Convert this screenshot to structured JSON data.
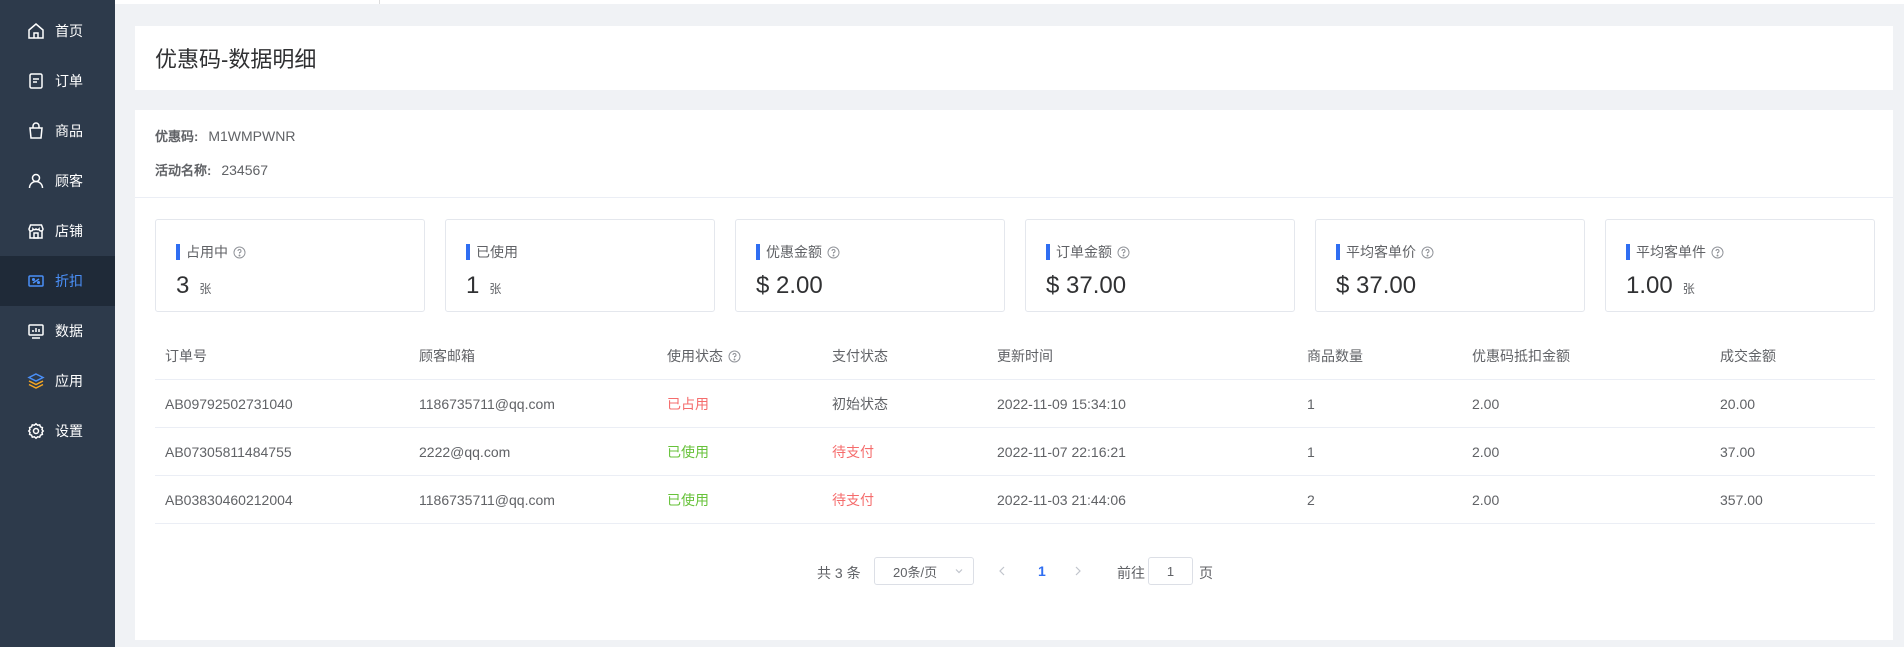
{
  "sidebar": {
    "items": [
      {
        "label": "首页",
        "icon": "home-icon"
      },
      {
        "label": "订单",
        "icon": "order-icon"
      },
      {
        "label": "商品",
        "icon": "bag-icon"
      },
      {
        "label": "顾客",
        "icon": "user-icon"
      },
      {
        "label": "店铺",
        "icon": "store-icon"
      },
      {
        "label": "折扣",
        "icon": "discount-icon"
      },
      {
        "label": "数据",
        "icon": "chart-icon"
      },
      {
        "label": "应用",
        "icon": "app-icon"
      },
      {
        "label": "设置",
        "icon": "gear-icon"
      }
    ],
    "active_index": 5,
    "active_color": "#4a8ff7",
    "background": "#2d3a4b"
  },
  "header": {
    "title": "优惠码-数据明细"
  },
  "info": {
    "code_label": "优惠码:",
    "code_value": "M1WMPWNR",
    "activity_label": "活动名称:",
    "activity_value": "234567"
  },
  "stats": [
    {
      "label": "占用中",
      "value": "3",
      "unit": "张",
      "help": true
    },
    {
      "label": "已使用",
      "value": "1",
      "unit": "张",
      "help": false
    },
    {
      "label": "优惠金额",
      "value": "$ 2.00",
      "unit": "",
      "help": true
    },
    {
      "label": "订单金额",
      "value": "$ 37.00",
      "unit": "",
      "help": true
    },
    {
      "label": "平均客单价",
      "value": "$ 37.00",
      "unit": "",
      "help": true
    },
    {
      "label": "平均客单件",
      "value": "1.00",
      "unit": "张",
      "help": true
    }
  ],
  "table": {
    "columns": [
      "订单号",
      "顾客邮箱",
      "使用状态",
      "支付状态",
      "更新时间",
      "商品数量",
      "优惠码抵扣金额",
      "成交金额"
    ],
    "rows": [
      [
        "AB09792502731040",
        "1186735711@qq.com",
        "已占用",
        "初始状态",
        "2022-11-09 15:34:10",
        "1",
        "2.00",
        "20.00"
      ],
      [
        "AB07305811484755",
        "2222@qq.com",
        "已使用",
        "待支付",
        "2022-11-07 22:16:21",
        "1",
        "2.00",
        "37.00"
      ],
      [
        "AB03830460212004",
        "1186735711@qq.com",
        "已使用",
        "待支付",
        "2022-11-03 21:44:06",
        "2",
        "2.00",
        "357.00"
      ]
    ],
    "row_colors": [
      [
        "",
        "",
        "#f56c6c",
        "",
        "",
        "",
        "",
        ""
      ],
      [
        "",
        "",
        "#67c23a",
        "#f56c6c",
        "",
        "",
        "",
        ""
      ],
      [
        "",
        "",
        "#67c23a",
        "#f56c6c",
        "",
        "",
        "",
        ""
      ]
    ]
  },
  "pagination": {
    "total": "共 3 条",
    "page_size": "20条/页",
    "current": "1",
    "goto_label": "前往",
    "goto_value": "1",
    "page_label": "页"
  }
}
